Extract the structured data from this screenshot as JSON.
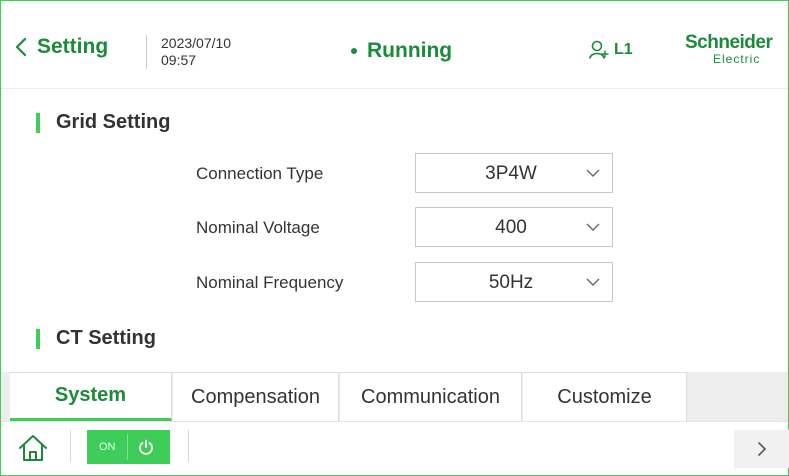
{
  "header": {
    "back_label": "Setting",
    "date": "2023/07/10",
    "time": "09:57",
    "status": "Running",
    "user_level": "L1",
    "logo_line1": "Schneider",
    "logo_line2": "Electric"
  },
  "grid_setting": {
    "title": "Grid Setting",
    "fields": [
      {
        "label": "Connection Type",
        "value": "3P4W"
      },
      {
        "label": "Nominal Voltage",
        "value": "400"
      },
      {
        "label": "Nominal Frequency",
        "value": "50Hz"
      }
    ]
  },
  "ct_setting": {
    "title": "CT Setting"
  },
  "tabs": [
    {
      "label": "System",
      "active": true
    },
    {
      "label": "Compensation",
      "active": false
    },
    {
      "label": "Communication",
      "active": false
    },
    {
      "label": "Customize",
      "active": false
    }
  ],
  "bottombar": {
    "toggle_label": "ON"
  },
  "colors": {
    "brand_green": "#3dcd58",
    "text_green": "#1b8a3a"
  },
  "icons": [
    "chevron-left-icon",
    "user-icon",
    "chevron-down-icon",
    "home-icon",
    "power-icon",
    "chevron-right-icon"
  ]
}
